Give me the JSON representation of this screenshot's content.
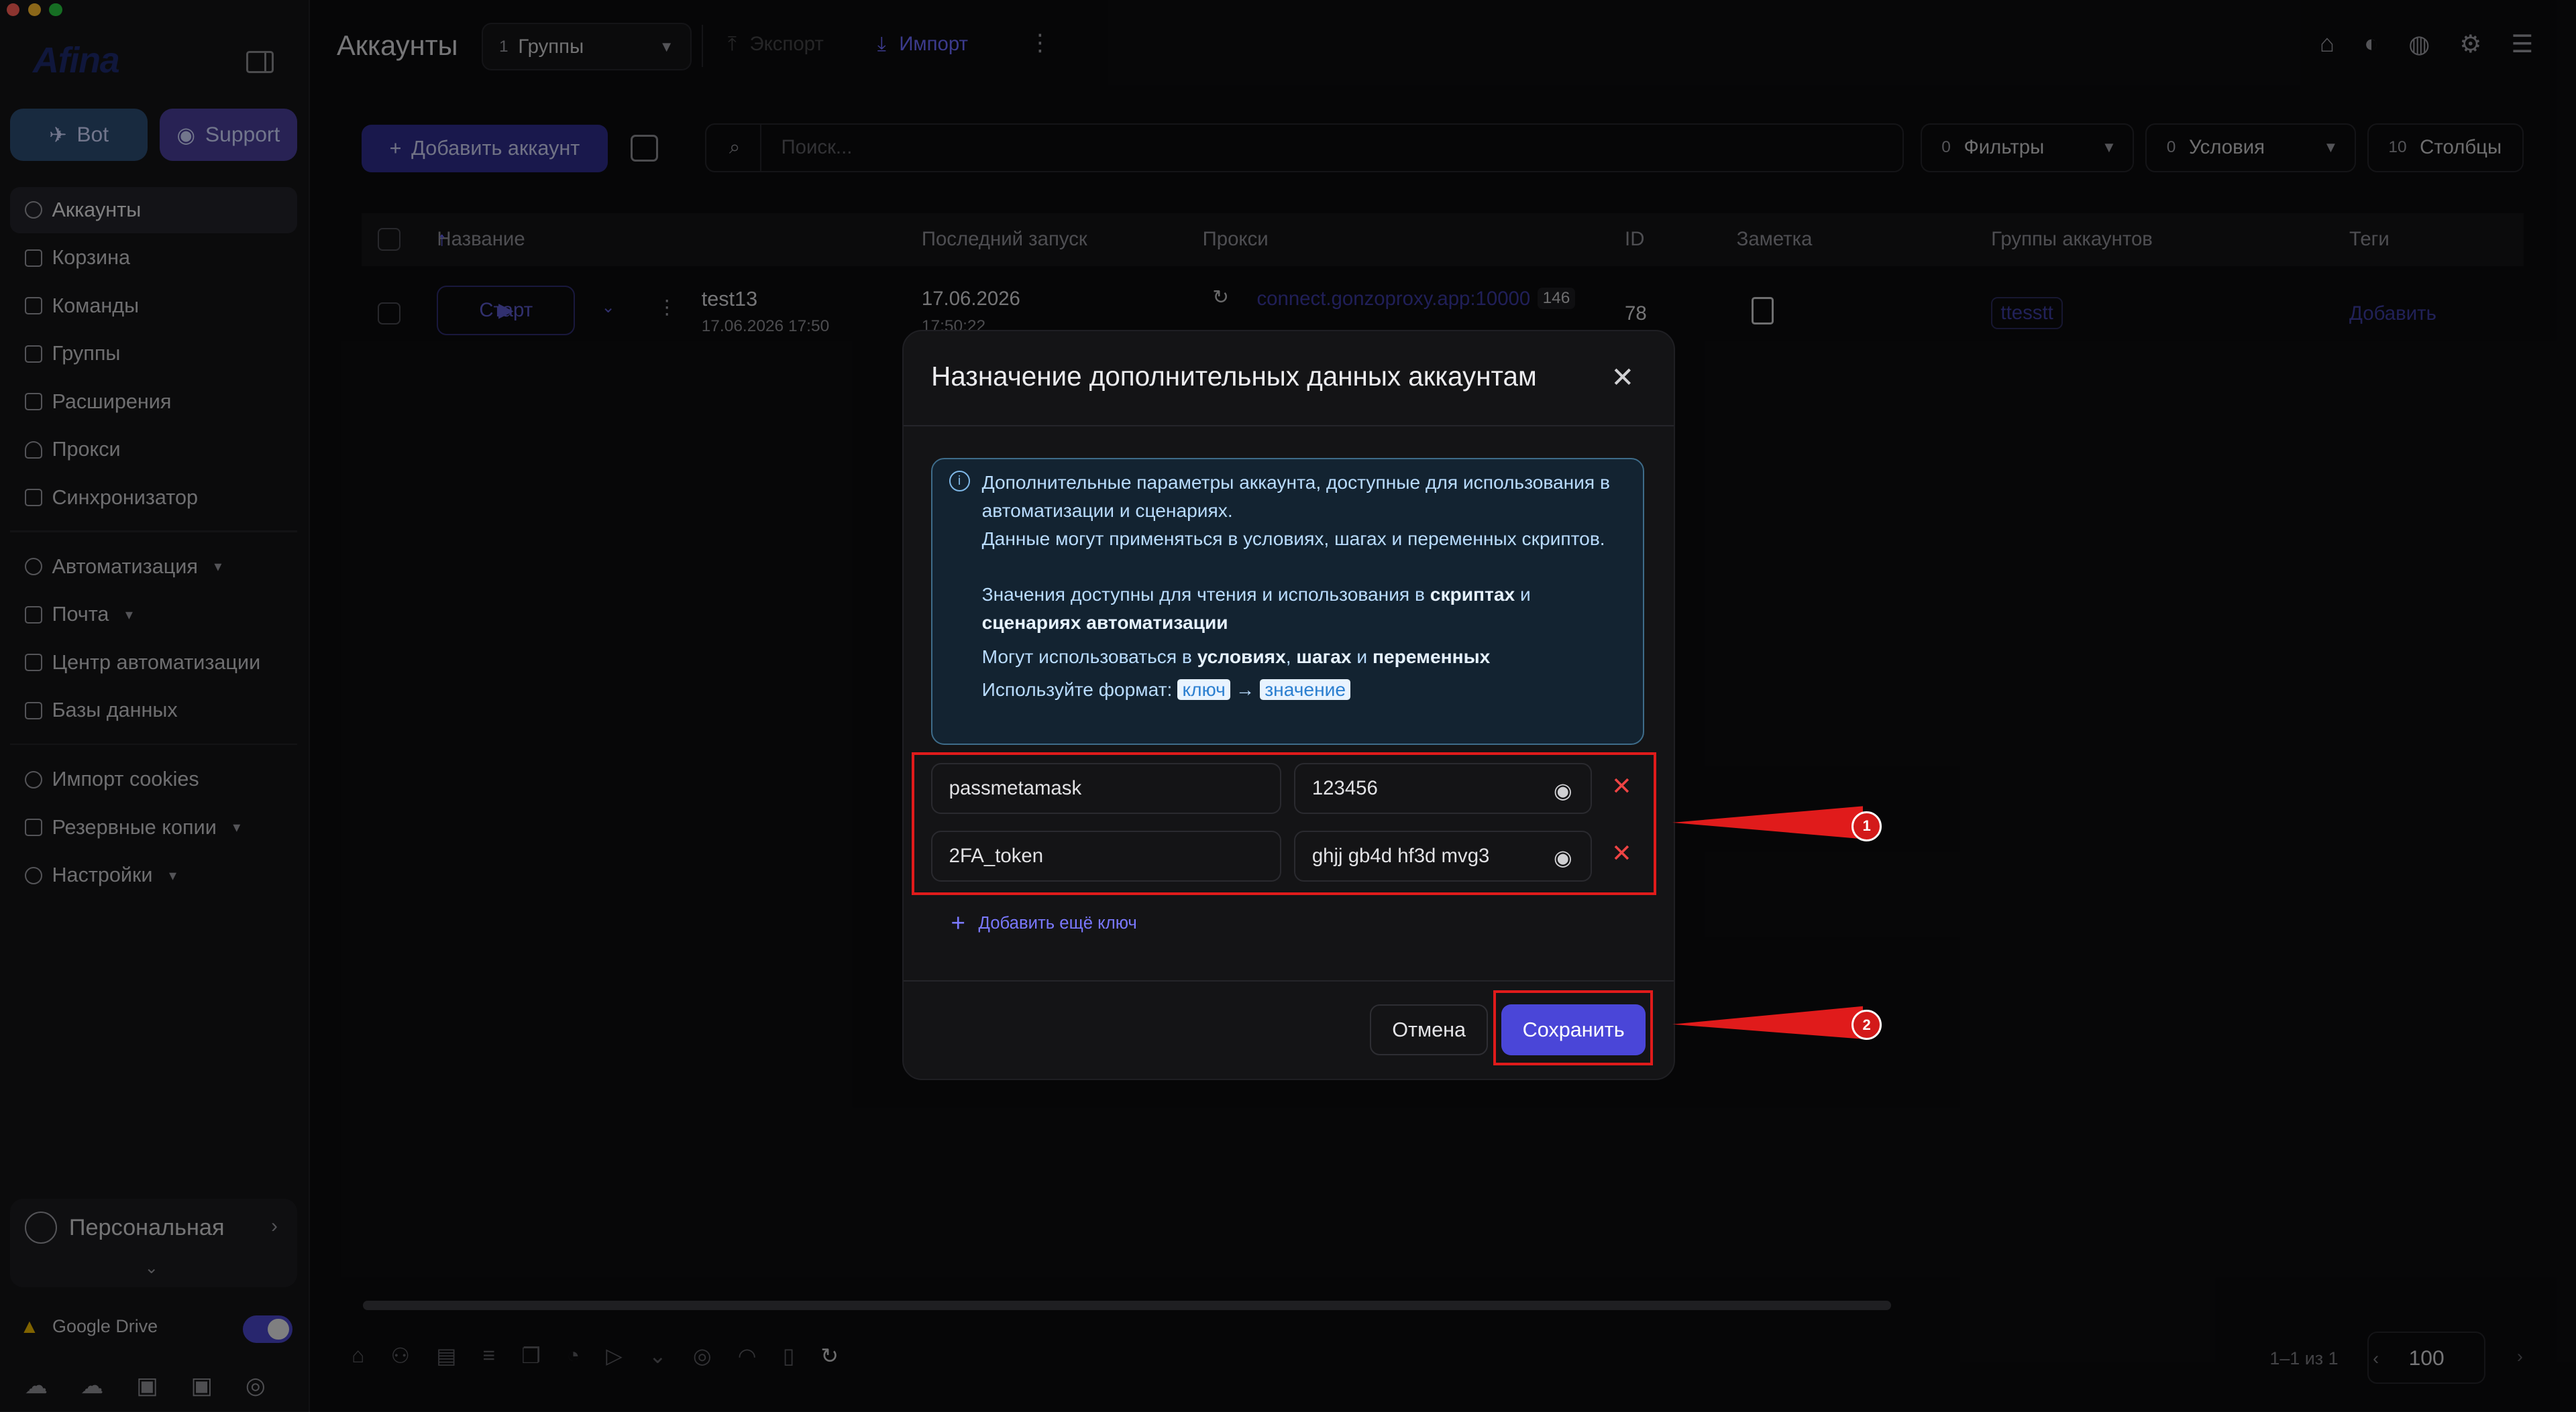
{
  "sidebar": {
    "logo": "Afina",
    "bot_label": "Bot",
    "support_label": "Support",
    "items": [
      {
        "label": "Аккаунты"
      },
      {
        "label": "Корзина"
      },
      {
        "label": "Команды"
      },
      {
        "label": "Группы"
      },
      {
        "label": "Расширения"
      },
      {
        "label": "Прокси"
      },
      {
        "label": "Синхронизатор"
      },
      {
        "label": "Автоматизация"
      },
      {
        "label": "Почта"
      },
      {
        "label": "Центр автоматизации"
      },
      {
        "label": "Базы данных"
      },
      {
        "label": "Импорт cookies"
      },
      {
        "label": "Резервные копии"
      },
      {
        "label": "Настройки"
      }
    ],
    "profile": "Персональная",
    "gdrive": "Google Drive"
  },
  "header": {
    "title": "Аккаунты",
    "groups_count": "1",
    "groups_label": "Группы",
    "export_label": "Экспорт",
    "import_label": "Импорт"
  },
  "toolbar": {
    "add_account": "Добавить аккаунт",
    "search_placeholder": "Поиск...",
    "filters_count": "0",
    "filters_label": "Фильтры",
    "conditions_count": "0",
    "conditions_label": "Условия",
    "columns_count": "10",
    "columns_label": "Столбцы"
  },
  "table": {
    "columns": [
      "Название",
      "Последний запуск",
      "Прокси",
      "ID",
      "Заметка",
      "Группы аккаунтов",
      "Теги"
    ],
    "row": {
      "start": "Старт",
      "name": "test13",
      "created": "17.06.2026 17:50",
      "last_run": "17.06.2026",
      "last_run_time": "17:50:22",
      "proxy": "connect.gonzoproxy.app:10000",
      "proxy_badge": "146",
      "id": "78",
      "group": "ttesstt",
      "tags": "Добавить"
    }
  },
  "footer": {
    "pager": "1–1 из 1",
    "page_size": "100"
  },
  "modal": {
    "title": "Назначение дополнительных данных аккаунтам",
    "info_p1": "Дополнительные параметры аккаунта, доступные для использования в автоматизации и сценариях.",
    "info_p2": "Данные могут применяться в условиях, шагах и переменных скриптов.",
    "info_p3a": "Значения доступны для чтения и использования в ",
    "info_p3b": "скриптах",
    "info_p3c": " и ",
    "info_p3d": "сценариях автоматизации",
    "info_p4a": "Могут использоваться в ",
    "info_p4b": "условиях",
    "info_p4c": ", ",
    "info_p4d": "шагах",
    "info_p4e": " и ",
    "info_p4f": "переменных",
    "info_p5": "Используйте формат:",
    "chip_key": "ключ",
    "chip_arrow": "→",
    "chip_value": "значение",
    "pairs": [
      {
        "key": "passmetamask",
        "value": "123456"
      },
      {
        "key": "2FA_token",
        "value": "ghjj gb4d hf3d mvg3"
      }
    ],
    "add_key": "Добавить ещё ключ",
    "cancel": "Отмена",
    "save": "Сохранить"
  },
  "annotations": {
    "badge1": "1",
    "badge2": "2"
  },
  "colors": {
    "accent": "#4a46d8",
    "highlight": "#e01b1b"
  }
}
